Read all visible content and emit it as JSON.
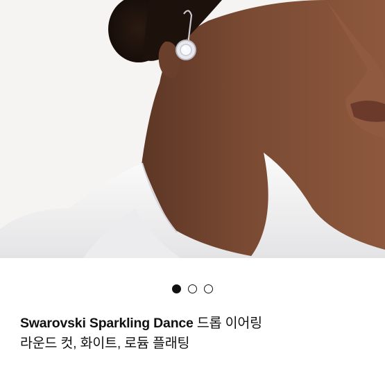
{
  "product": {
    "title_brand": "Swarovski Sparkling Dance",
    "title_rest_line1": " 드롭 이어링",
    "title_line2": "라운드 컷, 화이트, 로듐 플래팅"
  },
  "gallery": {
    "total_images": 3,
    "active_index": 0,
    "image_subject": "model-wearing-drop-earring"
  },
  "colors": {
    "background": "#ffffff",
    "text": "#111111",
    "dot_active": "#111111"
  }
}
